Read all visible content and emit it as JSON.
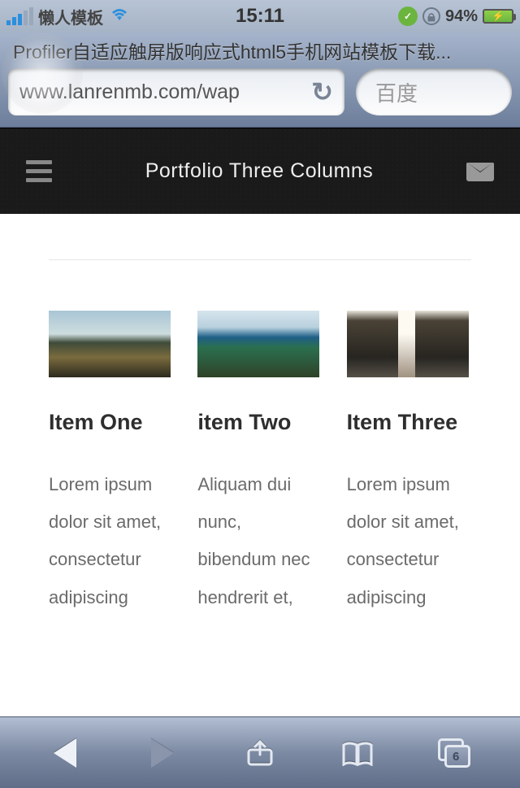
{
  "status": {
    "carrier": "懒人模板",
    "time": "15:11",
    "battery_pct": "94%"
  },
  "safari": {
    "page_title": "Profiler自适应触屏版响应式html5手机网站模板下载...",
    "url": "www.lanrenmb.com/wap",
    "search_placeholder": "百度",
    "tab_count": "6"
  },
  "header": {
    "title": "Portfolio Three Columns"
  },
  "items": [
    {
      "title": "Item One",
      "desc": "Lorem ipsum dolor sit amet, consectetur adipiscing"
    },
    {
      "title": "item Two",
      "desc": "Aliquam dui nunc, bibendum nec hendrerit et,"
    },
    {
      "title": "Item Three",
      "desc": "Lorem ipsum dolor sit amet, consectetur adipiscing"
    }
  ]
}
